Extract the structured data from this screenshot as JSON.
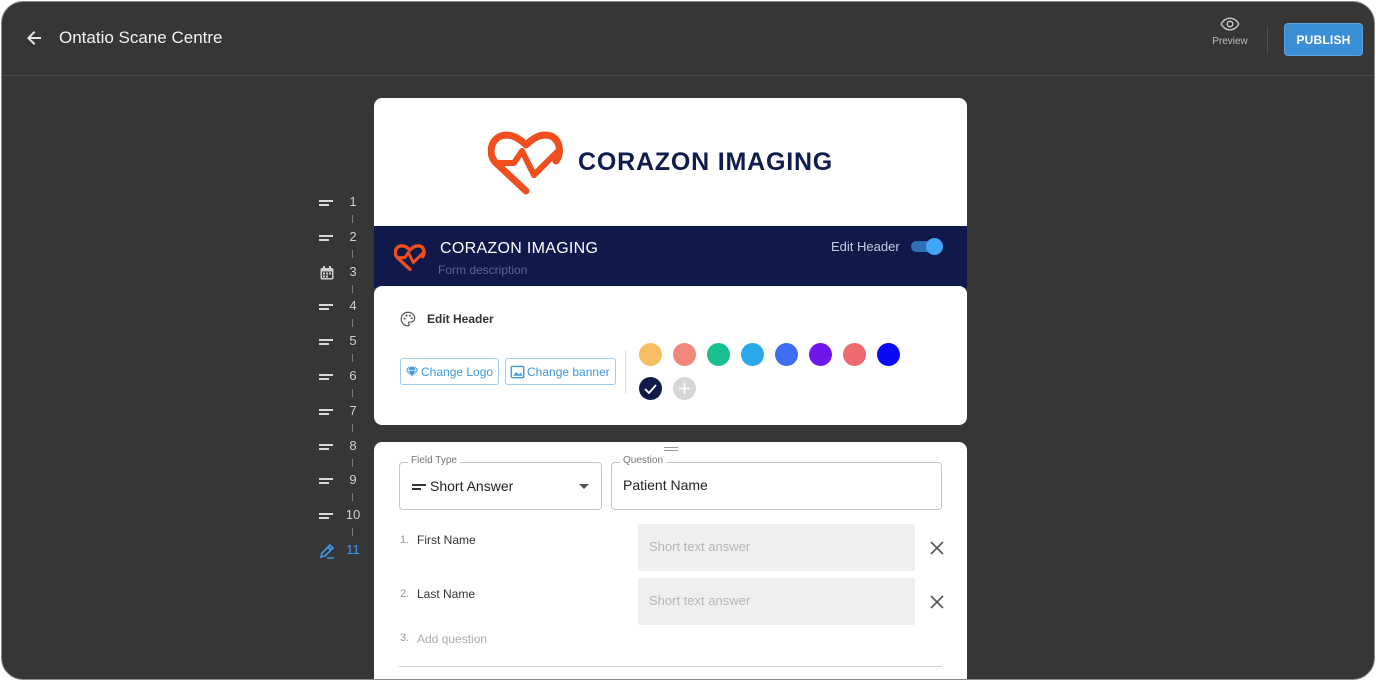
{
  "header": {
    "title": "Ontatio Scane Centre",
    "preview_label": "Preview",
    "publish_label": "PUBLISH"
  },
  "nav": {
    "items": [
      {
        "num": "1",
        "icon": "short-answer-icon"
      },
      {
        "num": "2",
        "icon": "short-answer-icon"
      },
      {
        "num": "3",
        "icon": "calendar-icon"
      },
      {
        "num": "4",
        "icon": "short-answer-icon"
      },
      {
        "num": "5",
        "icon": "short-answer-icon"
      },
      {
        "num": "6",
        "icon": "short-answer-icon"
      },
      {
        "num": "7",
        "icon": "short-answer-icon"
      },
      {
        "num": "8",
        "icon": "short-answer-icon"
      },
      {
        "num": "9",
        "icon": "short-answer-icon"
      },
      {
        "num": "10",
        "icon": "short-answer-icon"
      },
      {
        "num": "11",
        "icon": "edit-pencil-icon",
        "active": true
      }
    ]
  },
  "logo": {
    "text": "CORAZON IMAGING"
  },
  "banner": {
    "title": "CORAZON IMAGING",
    "description_placeholder": "Form description",
    "edit_header_label": "Edit Header",
    "edit_header_on": true
  },
  "edit_panel": {
    "title": "Edit Header",
    "change_logo_label": "Change Logo",
    "change_banner_label": "Change banner",
    "colors": [
      "#F7BE64",
      "#F0877A",
      "#18C08F",
      "#2BA8EC",
      "#3D6EF0",
      "#6F16EC",
      "#EF6A6E",
      "#0A0AF5"
    ],
    "selected_color": "#0F1A4A"
  },
  "question_card": {
    "field_type_legend": "Field Type",
    "field_type_value": "Short Answer",
    "question_legend": "Question",
    "question_value": "Patient Name",
    "subquestions": [
      {
        "num": "1.",
        "label": "First Name",
        "placeholder": "Short text answer"
      },
      {
        "num": "2.",
        "label": "Last Name",
        "placeholder": "Short text answer"
      }
    ],
    "add_num": "3.",
    "add_label": "Add question"
  }
}
